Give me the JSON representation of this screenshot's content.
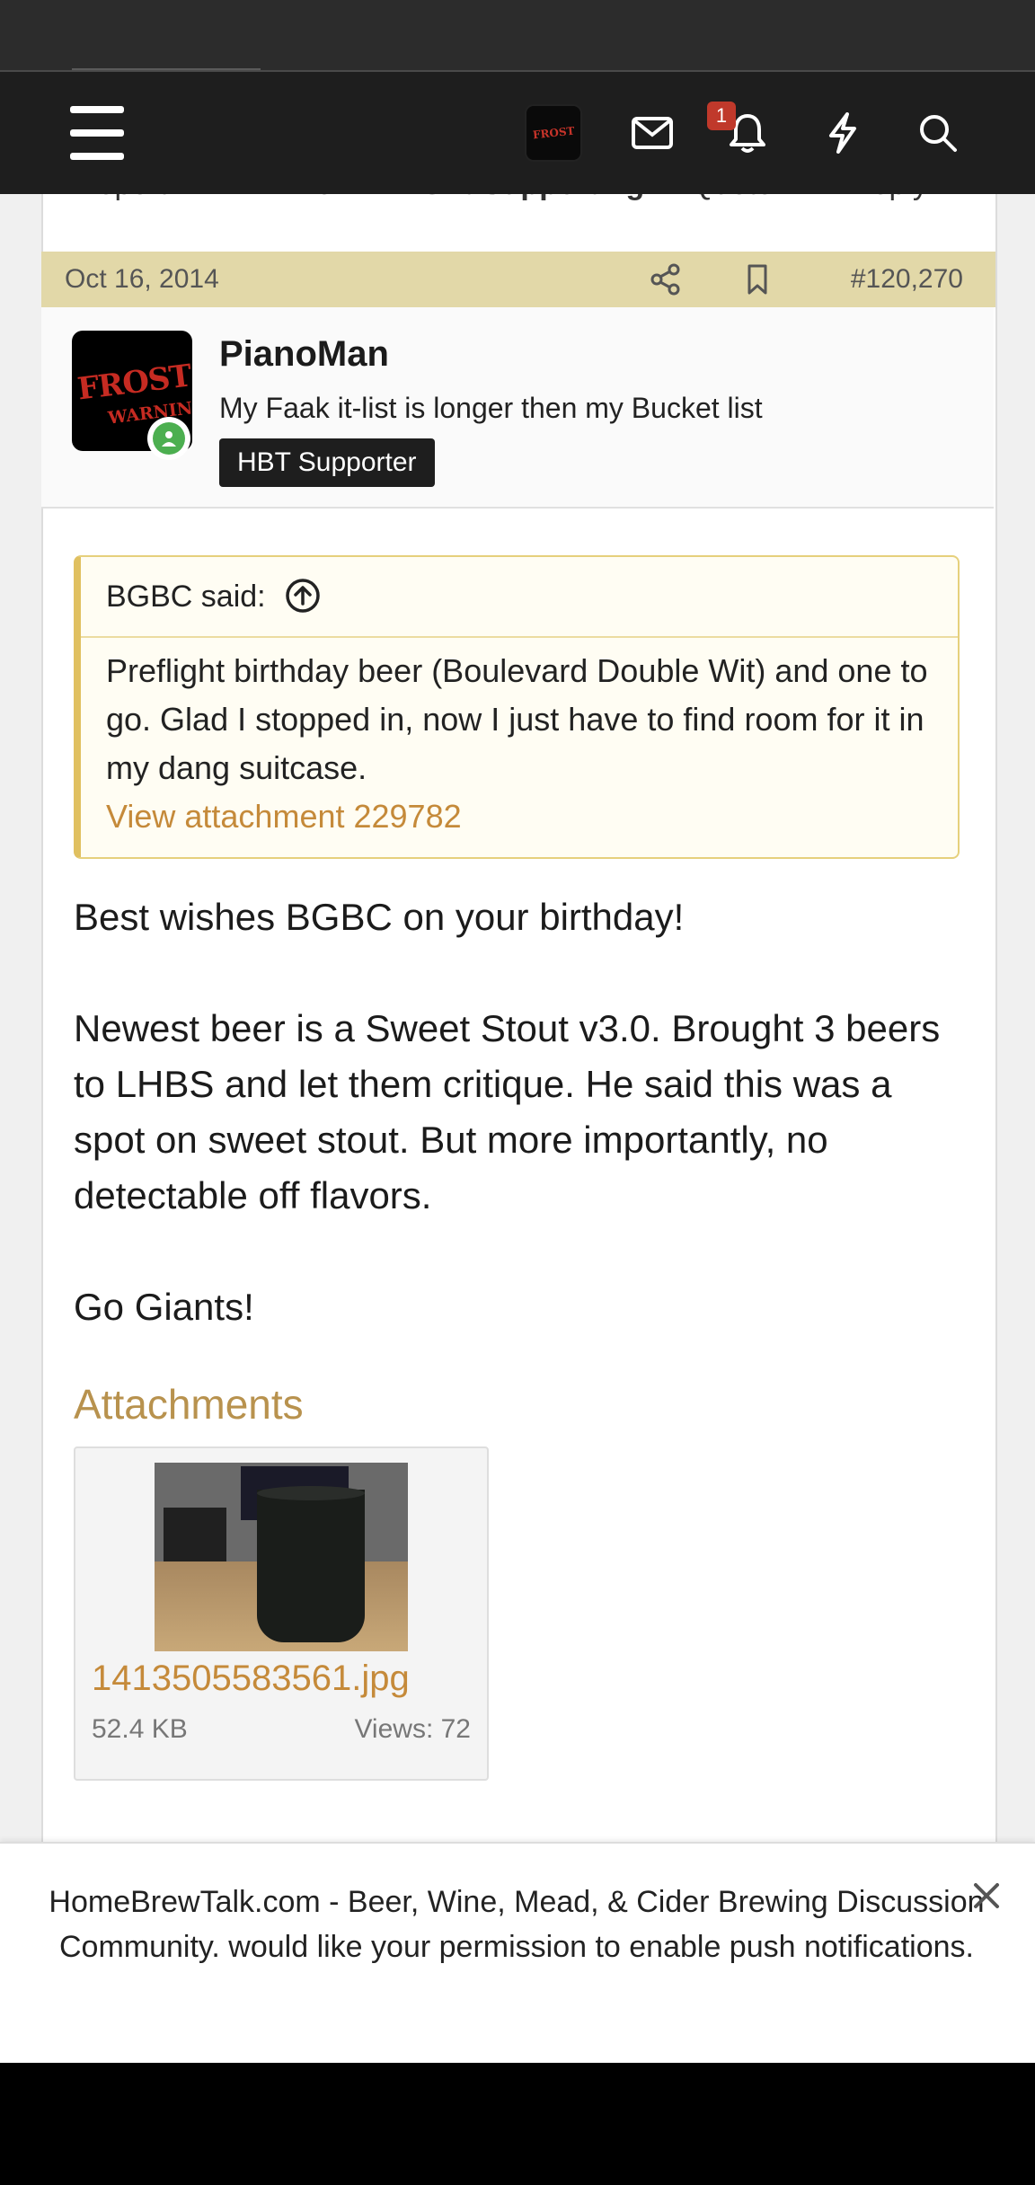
{
  "nav": {
    "menu_icon": "hamburger-icon",
    "avatar_icon": "avatar-thumbnail",
    "mail_icon": "envelope-icon",
    "bell_icon": "bell-icon",
    "notifications_badge": "1",
    "bolt_icon": "lightning-icon",
    "search_icon": "search-icon"
  },
  "prev_post_actions": [
    "Report",
    "Like",
    "Gift Supporting",
    "Quote",
    "Reply"
  ],
  "post": {
    "date": "Oct 16, 2014",
    "share_icon": "share-icon",
    "bookmark_icon": "bookmark-icon",
    "number": "#120,270"
  },
  "author": {
    "avatar_text_1": "FROST",
    "avatar_text_2": "WARNING",
    "name": "PianoMan",
    "title": "My Faak it-list is longer then my Bucket list",
    "banner": "HBT Supporter"
  },
  "quote": {
    "author": "BGBC said:",
    "jump_icon": "arrow-up-circle-icon",
    "text": "Preflight birthday beer (Boulevard Double Wit) and one to go. Glad I stopped in, now I just have to find room for it in my dang suitcase.",
    "attachment_link": "View attachment 229782"
  },
  "message": {
    "line1": "Best wishes BGBC on your birthday!",
    "line2": "Newest beer is a Sweet Stout v3.0. Brought 3 beers to LHBS and let them critique. He said this was a spot on sweet stout. But more importantly, no detectable off flavors.",
    "line3": "Go Giants!"
  },
  "attachments": {
    "title": "Attachments",
    "items": [
      {
        "name": "1413505583561.jpg",
        "size": "52.4 KB",
        "views": "Views: 72"
      }
    ]
  },
  "push_prompt": {
    "text": "HomeBrewTalk.com - Beer, Wine, Mead, & Cider Brewing Discussion Community. would like your permission to enable push notifications.",
    "close_icon": "close-icon"
  },
  "colors": {
    "navbar": "#1e1e1e",
    "post_bar": "#e2d8a8",
    "link": "#c58a3a",
    "badge": "#c0392b",
    "online": "#4caf50"
  }
}
